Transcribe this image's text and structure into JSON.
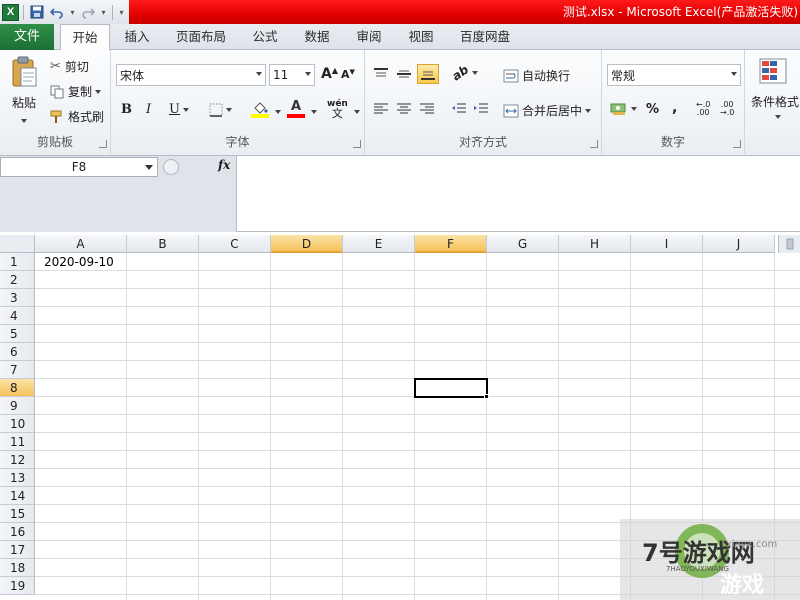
{
  "window": {
    "title": "测试.xlsx - Microsoft Excel(产品激活失败)"
  },
  "qat": {
    "app_icon": "X",
    "save_icon": "save-icon",
    "undo_icon": "undo-icon",
    "redo_icon": "redo-icon"
  },
  "tabs": {
    "file": "文件",
    "items": [
      "开始",
      "插入",
      "页面布局",
      "公式",
      "数据",
      "审阅",
      "视图",
      "百度网盘"
    ]
  },
  "ribbon": {
    "clipboard": {
      "paste": "粘贴",
      "cut": "剪切",
      "copy": "复制",
      "format_painter": "格式刷",
      "label": "剪贴板"
    },
    "font": {
      "font_name": "宋体",
      "font_size": "11",
      "bold": "B",
      "italic": "I",
      "underline": "U",
      "grow": "A",
      "shrink": "A",
      "label": "字体"
    },
    "alignment": {
      "wrap_text": "自动换行",
      "merge_center": "合并后居中",
      "label": "对齐方式"
    },
    "number": {
      "format": "常规",
      "percent": "%",
      "comma": ",",
      "label": "数字"
    },
    "styles": {
      "conditional_format": "条件格式"
    },
    "colors": {
      "fill_highlight": "#ffff00",
      "font_color": "#ff0000"
    }
  },
  "formula_bar": {
    "name_box": "F8",
    "fx_label": "fx",
    "content": ""
  },
  "sheet": {
    "columns": [
      "A",
      "B",
      "C",
      "D",
      "E",
      "F",
      "G",
      "H",
      "I",
      "J"
    ],
    "rows": [
      "1",
      "2",
      "3",
      "4",
      "5",
      "6",
      "7",
      "8",
      "9",
      "10",
      "11",
      "12",
      "13",
      "14",
      "15",
      "16",
      "17",
      "18",
      "19"
    ],
    "selected_column": "F",
    "highlighted_column": "D",
    "selected_row": "8",
    "cells": {
      "A1": "2020-09-10"
    }
  },
  "watermark": {
    "brand": "7号游戏网",
    "domain": "xiayx.com",
    "pinyin": "7HAOYOUXIWANG",
    "slogan": "游戏"
  }
}
